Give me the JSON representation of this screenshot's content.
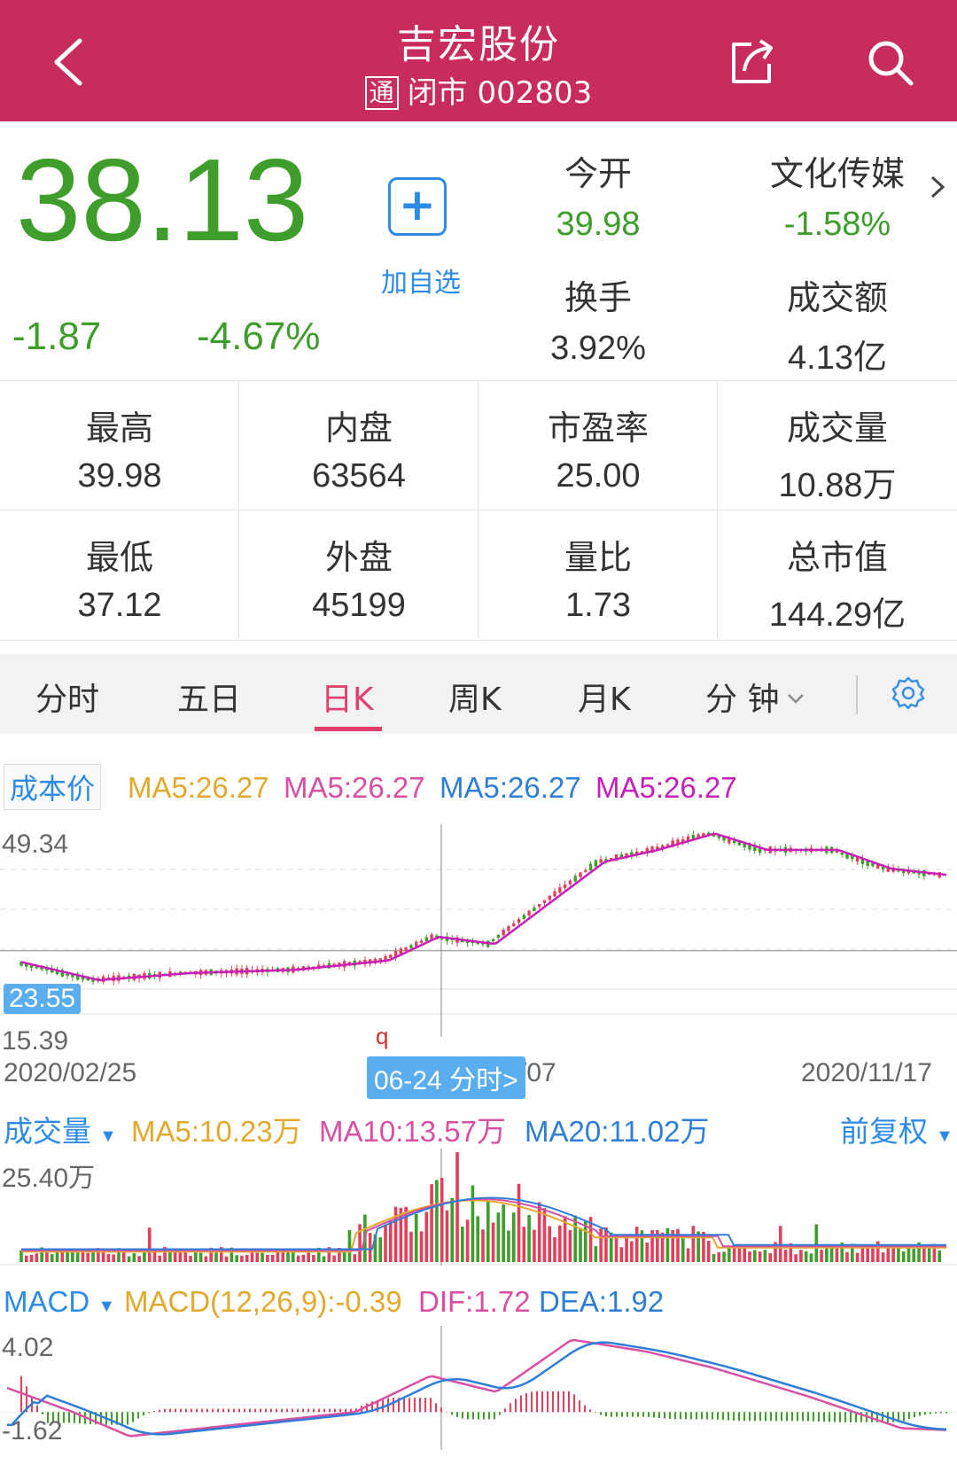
{
  "header": {
    "title": "吉宏股份",
    "tong": "通",
    "status_code": "闭市 002803"
  },
  "quote": {
    "price": "38.13",
    "change": "-1.87",
    "change_pct": "-4.67%",
    "add_label": "加自选",
    "open_label": "今开",
    "open_value": "39.98",
    "sector_label": "文化传媒",
    "sector_value": "-1.58%",
    "turnover_label": "换手",
    "turnover_value": "3.92%",
    "amount_label": "成交额",
    "amount_value": "4.13亿"
  },
  "stats": [
    {
      "label": "最高",
      "value": "39.98",
      "green": true
    },
    {
      "label": "内盘",
      "value": "63564"
    },
    {
      "label": "市盈率",
      "value": "25.00"
    },
    {
      "label": "成交量",
      "value": "10.88万"
    },
    {
      "label": "最低",
      "value": "37.12",
      "green": true
    },
    {
      "label": "外盘",
      "value": "45199"
    },
    {
      "label": "量比",
      "value": "1.73"
    },
    {
      "label": "总市值",
      "value": "144.29亿"
    }
  ],
  "tabs": [
    "分时",
    "五日",
    "日K",
    "周K",
    "月K",
    "分 钟"
  ],
  "active_tab": "日K",
  "colors": {
    "brand": "#c72c5c",
    "up": "#e0405a",
    "down": "#3e9d2b",
    "accent": "#2d8be8",
    "ma_yellow": "#e2a92c",
    "ma_pink": "#d94fa3",
    "ma_blue": "#2e7ed8",
    "ma_magenta": "#c81fb8"
  },
  "kline": {
    "badge": "成本价",
    "ma_labels": [
      "MA5:26.27",
      "MA5:26.27",
      "MA5:26.27",
      "MA5:26.27"
    ],
    "y_max": "49.34",
    "y_min": "15.39",
    "crosshair_value": "23.55",
    "start_date": "2020/02/25",
    "end_date": "2020/11/17",
    "cursor_label": "06-24 分时>",
    "partial_date": "/07",
    "marker": "q"
  },
  "volume": {
    "title": "成交量",
    "ma5": "MA5:10.23万",
    "ma10": "MA10:13.57万",
    "ma20": "MA20:11.02万",
    "adjust": "前复权",
    "y_max": "25.40万"
  },
  "macd": {
    "title": "MACD",
    "params": "MACD(12,26,9):-0.39",
    "dif": "DIF:1.72",
    "dea": "DEA:1.92",
    "y_max": "4.02",
    "y_min": "-1.62"
  },
  "chart_data": {
    "type": "line",
    "x_range": [
      "2020/02/25",
      "2020/11/17"
    ],
    "y_range": [
      15.39,
      49.34
    ],
    "close_approx": [
      {
        "x": "2020/02/25",
        "y": 21.5
      },
      {
        "x": "2020/03/20",
        "y": 17.3
      },
      {
        "x": "2020/04/15",
        "y": 18.8
      },
      {
        "x": "2020/05/15",
        "y": 19.5
      },
      {
        "x": "2020/06/10",
        "y": 21.5
      },
      {
        "x": "2020/06/24",
        "y": 26.5
      },
      {
        "x": "2020/07/10",
        "y": 25.0
      },
      {
        "x": "2020/07/25",
        "y": 33.5
      },
      {
        "x": "2020/08/10",
        "y": 42.5
      },
      {
        "x": "2020/08/25",
        "y": 45.0
      },
      {
        "x": "2020/09/10",
        "y": 48.5
      },
      {
        "x": "2020/09/25",
        "y": 45.0
      },
      {
        "x": "2020/10/15",
        "y": 45.0
      },
      {
        "x": "2020/10/30",
        "y": 41.0
      },
      {
        "x": "2020/11/17",
        "y": 39.5
      }
    ]
  }
}
